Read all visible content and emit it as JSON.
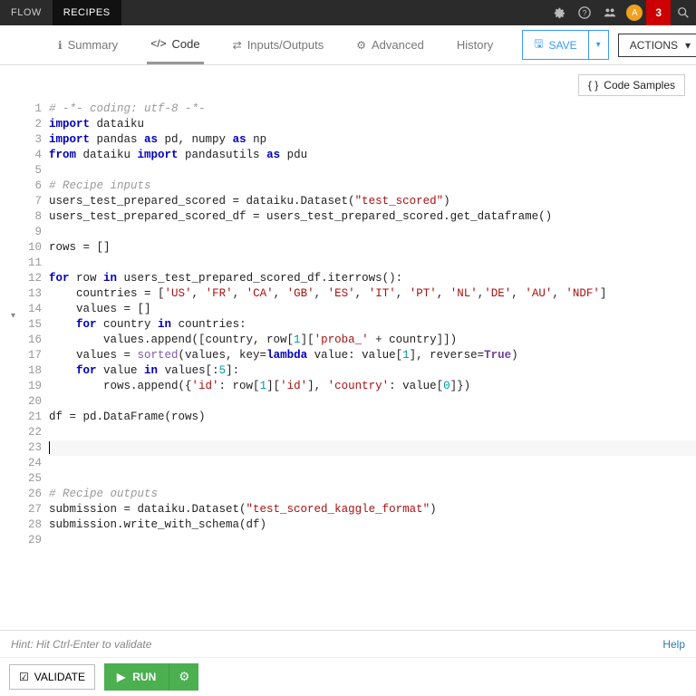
{
  "topnav": {
    "items": [
      "FLOW",
      "RECIPES"
    ],
    "activeIndex": 1
  },
  "topright": {
    "avatarInitial": "A",
    "notifCount": "3"
  },
  "subnav": {
    "tabs": [
      {
        "label": "Summary"
      },
      {
        "label": "Code"
      },
      {
        "label": "Inputs/Outputs"
      },
      {
        "label": "Advanced"
      },
      {
        "label": "History"
      }
    ],
    "activeIndex": 1,
    "saveLabel": "SAVE",
    "actionsLabel": "ACTIONS"
  },
  "codeSamplesLabel": "Code Samples",
  "lineCount": 29,
  "foldAtLine": 12,
  "code": {
    "l1": "# -*- coding: utf-8 -*-",
    "l2a": "import",
    "l2b": " dataiku",
    "l3a": "import",
    "l3b": " pandas ",
    "l3c": "as",
    "l3d": " pd, numpy ",
    "l3e": "as",
    "l3f": " np",
    "l4a": "from",
    "l4b": " dataiku ",
    "l4c": "import",
    "l4d": " pandasutils ",
    "l4e": "as",
    "l4f": " pdu",
    "l6": "# Recipe inputs",
    "l7a": "users_test_prepared_scored = dataiku.Dataset(",
    "l7b": "\"test_scored\"",
    "l7c": ")",
    "l8": "users_test_prepared_scored_df = users_test_prepared_scored.get_dataframe()",
    "l10": "rows = []",
    "l12a": "for",
    "l12b": " row ",
    "l12c": "in",
    "l12d": " users_test_prepared_scored_df.iterrows():",
    "l13a": "    countries = [",
    "l13b": "'US'",
    "l13c": ", ",
    "l13d": "'FR'",
    "l13e": ", ",
    "l13f": "'CA'",
    "l13g": ", ",
    "l13h": "'GB'",
    "l13i": ", ",
    "l13j": "'ES'",
    "l13k": ", ",
    "l13l": "'IT'",
    "l13m": ", ",
    "l13n": "'PT'",
    "l13o": ", ",
    "l13p": "'NL'",
    "l13q": ",",
    "l13r": "'DE'",
    "l13s": ", ",
    "l13t": "'AU'",
    "l13u": ", ",
    "l13v": "'NDF'",
    "l13w": "]",
    "l14": "    values = []",
    "l15a": "    ",
    "l15b": "for",
    "l15c": " country ",
    "l15d": "in",
    "l15e": " countries:",
    "l16a": "        values.append([country, row[",
    "l16b": "1",
    "l16c": "][",
    "l16d": "'proba_'",
    "l16e": " + country]])",
    "l17a": "    values = ",
    "l17b": "sorted",
    "l17c": "(values, key=",
    "l17d": "lambda",
    "l17e": " value: value[",
    "l17f": "1",
    "l17g": "], reverse=",
    "l17h": "True",
    "l17i": ")",
    "l18a": "    ",
    "l18b": "for",
    "l18c": " value ",
    "l18d": "in",
    "l18e": " values[:",
    "l18f": "5",
    "l18g": "]:",
    "l19a": "        rows.append({",
    "l19b": "'id'",
    "l19c": ": row[",
    "l19d": "1",
    "l19e": "][",
    "l19f": "'id'",
    "l19g": "], ",
    "l19h": "'country'",
    "l19i": ": value[",
    "l19j": "0",
    "l19k": "]})",
    "l21": "df = pd.DataFrame(rows)",
    "l26": "# Recipe outputs",
    "l27a": "submission = dataiku.Dataset(",
    "l27b": "\"test_scored_kaggle_format\"",
    "l27c": ")",
    "l28": "submission.write_with_schema(df)"
  },
  "footer": {
    "hint": "Hint: Hit Ctrl-Enter to validate",
    "helpLabel": "Help"
  },
  "runbar": {
    "validateLabel": "VALIDATE",
    "runLabel": "RUN"
  }
}
